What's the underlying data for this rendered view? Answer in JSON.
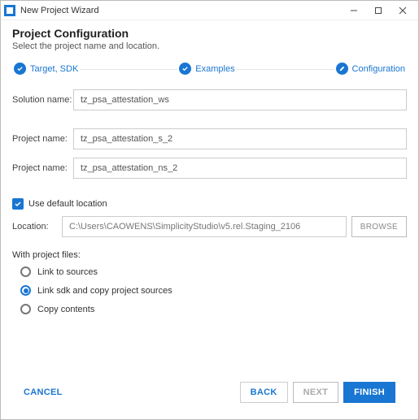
{
  "window": {
    "title": "New Project Wizard"
  },
  "header": {
    "title": "Project Configuration",
    "subtitle": "Select the project name and location."
  },
  "stepper": {
    "step1": "Target, SDK",
    "step2": "Examples",
    "step3": "Configuration"
  },
  "form": {
    "solution_label": "Solution name:",
    "solution_value": "tz_psa_attestation_ws",
    "project1_label": "Project name:",
    "project1_value": "tz_psa_attestation_s_2",
    "project2_label": "Project name:",
    "project2_value": "tz_psa_attestation_ns_2",
    "use_default_location": "Use default location",
    "location_label": "Location:",
    "location_value": "C:\\Users\\CAOWENS\\SimplicityStudio\\v5.rel.Staging_2106",
    "browse": "BROWSE",
    "files_section": "With project files:",
    "radio1": "Link to sources",
    "radio2": "Link sdk and copy project sources",
    "radio3": "Copy contents"
  },
  "footer": {
    "cancel": "CANCEL",
    "back": "BACK",
    "next": "NEXT",
    "finish": "FINISH"
  }
}
